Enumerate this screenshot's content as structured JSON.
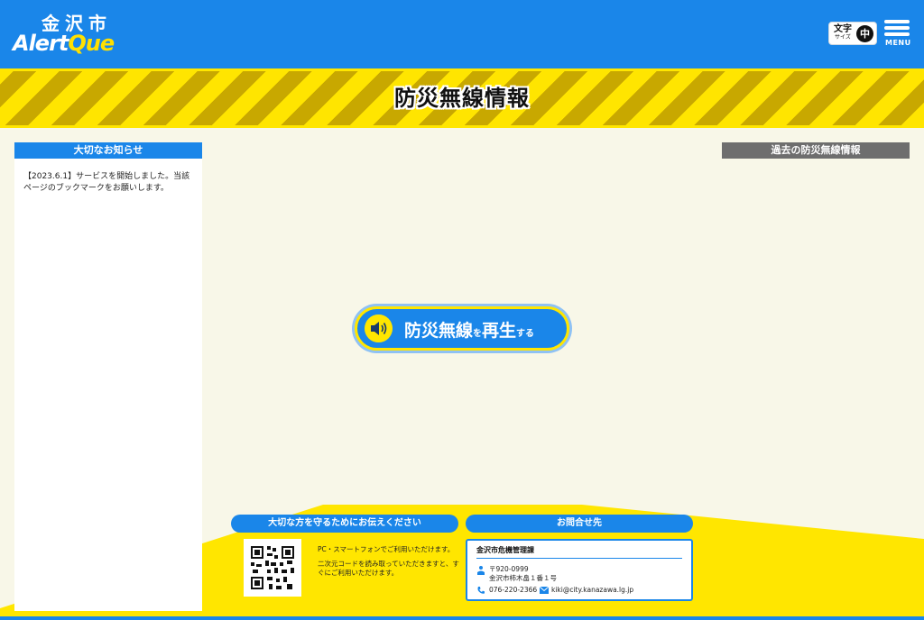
{
  "header": {
    "logo_city": "金沢市",
    "logo_app_part1": "Alert",
    "logo_app_part2": "Que",
    "font_size_label": "文字",
    "font_size_sub": "サイズ",
    "font_size_value": "中",
    "menu_label": "MENU"
  },
  "banner": {
    "title": "防災無線情報"
  },
  "notices": {
    "heading": "大切なお知らせ",
    "items": [
      "【2023.6.1】サービスを開始しました。当該ページのブックマークをお願いします。"
    ]
  },
  "past": {
    "heading": "過去の防災無線情報"
  },
  "play_button": {
    "text_main": "防災無線",
    "text_particle": "を",
    "text_main2": "再生",
    "text_suffix": "する",
    "icon": "speaker-icon"
  },
  "footer": {
    "share_heading": "大切な方を守るためにお伝えください",
    "share_text1": "PC・スマートフォンでご利用いただけます。",
    "share_text2": "二次元コードを読み取っていただきますと、すぐにご利用いただけます。",
    "contact_heading": "お問合せ先",
    "contact_org": "金沢市危機管理課",
    "contact_postal": "〒920-0999",
    "contact_address": "金沢市柿木畠１番１号",
    "contact_phone": "076-220-2366",
    "contact_email": "kiki@city.kanazawa.lg.jp"
  },
  "colors": {
    "brand_blue": "#1a86e9",
    "yellow": "#ffe600",
    "background": "#f8f7e8",
    "past_heading_gray": "#6e6e6e"
  }
}
